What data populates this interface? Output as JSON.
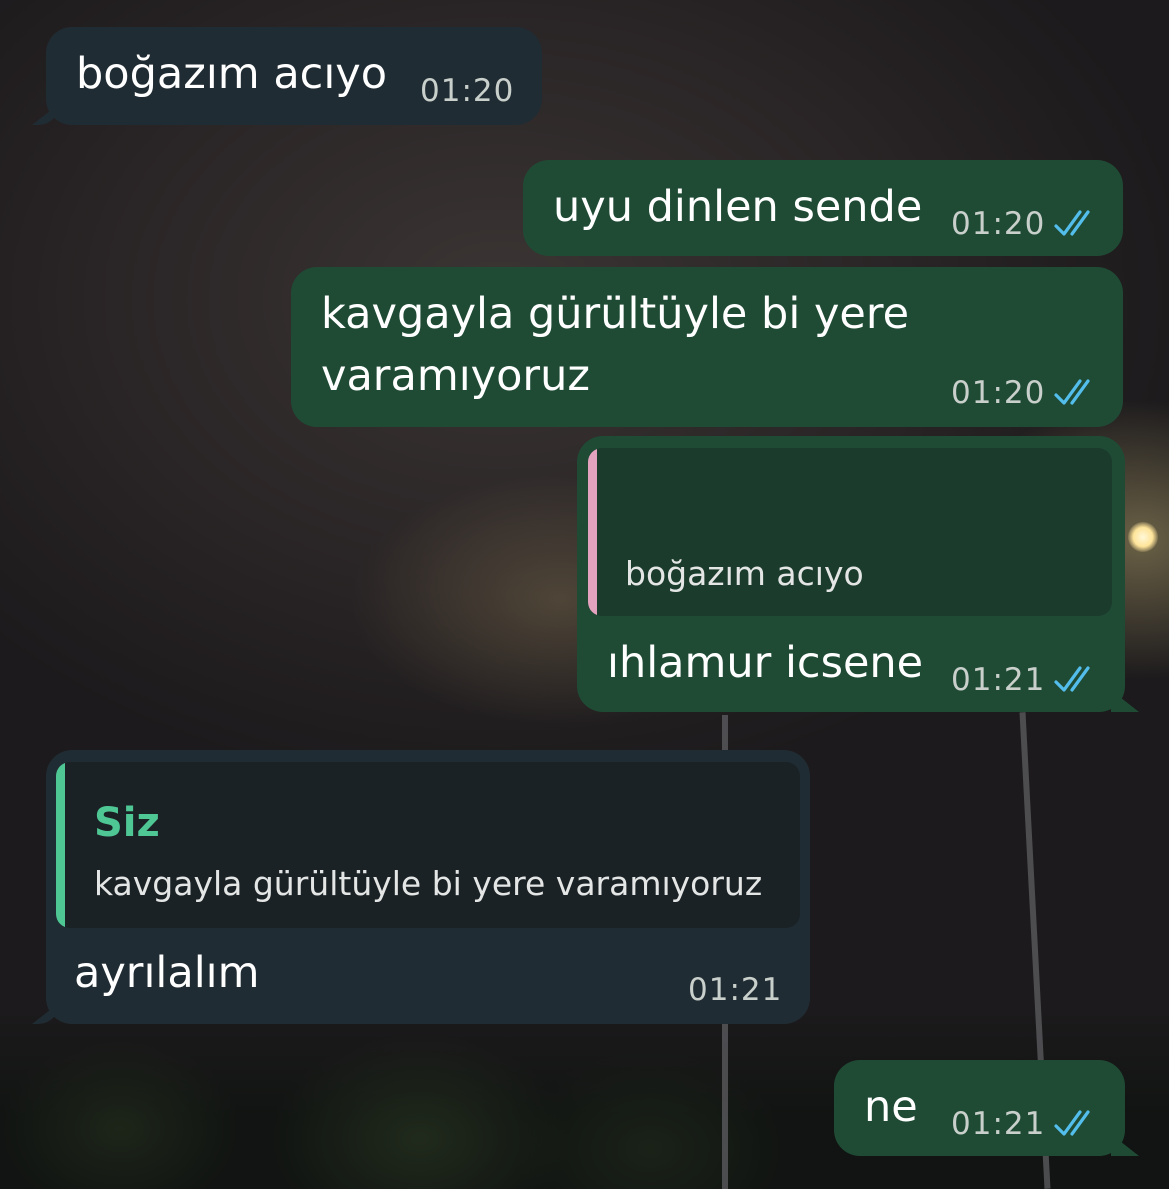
{
  "chat": {
    "messages": [
      {
        "id": "m1",
        "direction": "incoming",
        "text": "boğazım acıyo",
        "time": "01:20"
      },
      {
        "id": "m2",
        "direction": "outgoing",
        "text": "uyu dinlen sende",
        "time": "01:20",
        "status": "read"
      },
      {
        "id": "m3",
        "direction": "outgoing",
        "text_lines": [
          "kavgayla gürültüyle bi yere",
          "varamıyoruz"
        ],
        "time": "01:20",
        "status": "read"
      },
      {
        "id": "m4",
        "direction": "outgoing",
        "reply_to": {
          "text": "boğazım acıyo"
        },
        "text": "ıhlamur icsene",
        "time": "01:21",
        "status": "read"
      },
      {
        "id": "m5",
        "direction": "incoming",
        "reply_to": {
          "author": "Siz",
          "text": "kavgayla gürültüyle bi yere varamıyoruz"
        },
        "text": "ayrılalım",
        "time": "01:21"
      },
      {
        "id": "m6",
        "direction": "outgoing",
        "text": "ne",
        "time": "01:21",
        "status": "read"
      }
    ]
  },
  "colors": {
    "incoming_bubble": "#202c33",
    "outgoing_bubble": "#1f4b35",
    "read_ticks": "#53bdeb",
    "quote_bar_own": "#4fc795",
    "quote_bar_other": "#e3a3bf"
  },
  "icons": {
    "read_receipt": "double-check-icon"
  }
}
